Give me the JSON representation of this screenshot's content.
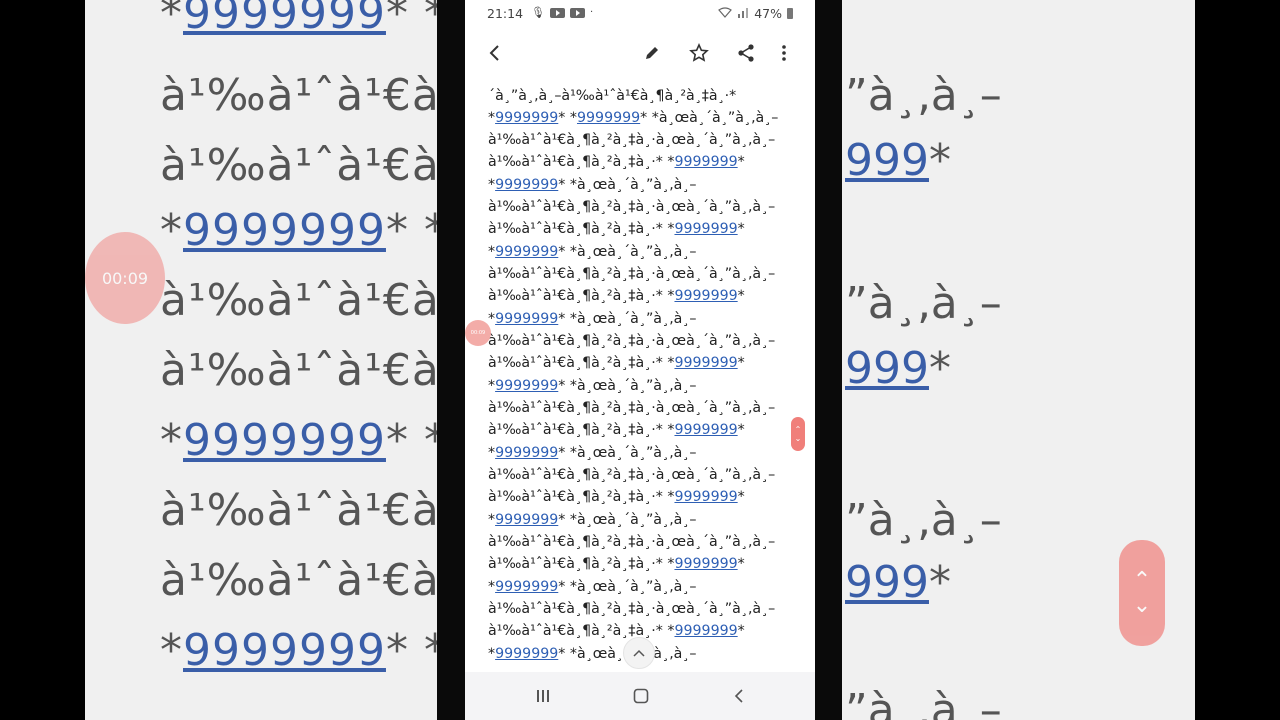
{
  "status_bar": {
    "time": "21:14",
    "battery": "47%"
  },
  "toolbar": {
    "back_icon": "back-arrow-icon",
    "edit_icon": "pencil-icon",
    "star_icon": "star-icon",
    "share_icon": "share-icon",
    "more_icon": "more-vertical-icon"
  },
  "content": {
    "top_partial": "´à¸”à¸‚à¸–à¹‰à¹ˆà¹€à¸¶à¸²à¸‡à¸·*",
    "row_a_prefix": "*",
    "row_a_link1": "9999999",
    "row_a_mid": "* *",
    "row_a_link2": "9999999",
    "row_a_suffix": "* *à¸œà¸´à¸”à¸‚à¸–",
    "line_b": "à¹‰à¹ˆà¹€à¸¶à¸²à¸‡à¸·à¸œà¸´à¸”à¸‚à¸–",
    "line_c_prefix": "à¹‰à¹ˆà¹€à¸¶à¸²à¸‡à¸·* *",
    "link": "9999999",
    "line_c_suffix": "*",
    "line_d_prefix": "*",
    "line_d_suffix": "* *à¸œà¸´à¸”à¸‚à¸–",
    "line_e": "à¹‰à¹ˆà¹€à¸¶à¸²à¸‡à¸·à¸œà¸´à¸”à¸‚à¸–"
  },
  "overlay": {
    "timer_label": "00:09"
  },
  "background": {
    "line1_link": "9999999",
    "line2": "à¹‰à¹ˆà¹€à",
    "line3_link": "9999999",
    "right_a": "”à¸‚à¸–",
    "right_b": "999",
    "timer": "00:09"
  }
}
